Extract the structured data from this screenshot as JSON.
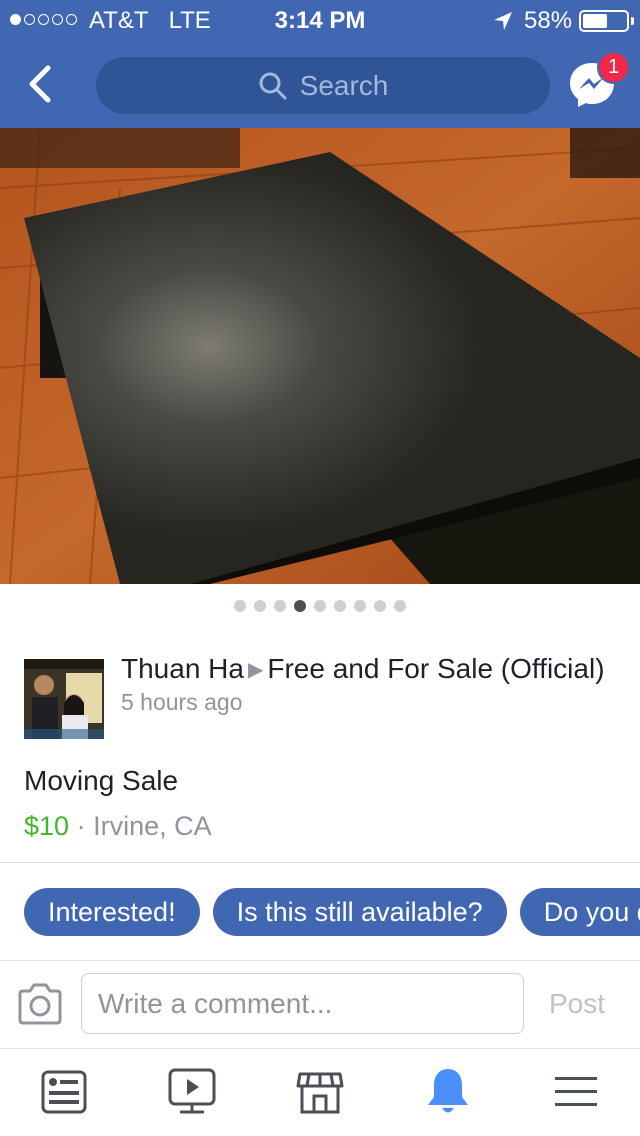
{
  "status_bar": {
    "carrier": "AT&T",
    "network": "LTE",
    "time": "3:14 PM",
    "battery_percent": "58%",
    "battery_level": 0.58,
    "signal_bars": 1,
    "icons": [
      "signal-dots",
      "location-arrow-icon",
      "battery-icon"
    ]
  },
  "nav": {
    "back_icon": "chevron-left-icon",
    "search_placeholder": "Search",
    "messenger_icon": "messenger-icon",
    "messenger_badge": "1"
  },
  "photo": {
    "carousel_count": 9,
    "active_index": 3
  },
  "post": {
    "author": "Thuan Ha",
    "group": "Free and For Sale (Official)",
    "time_ago": "5 hours ago",
    "item_title": "Moving Sale",
    "price": "$10",
    "separator": "·",
    "location": "Irvine, CA"
  },
  "quick_replies": [
    "Interested!",
    "Is this still available?",
    "Do you deliver?"
  ],
  "comment": {
    "placeholder": "Write a comment...",
    "post_label": "Post"
  },
  "tab_bar": [
    {
      "name": "news-feed",
      "icon": "news-feed-icon",
      "active": false
    },
    {
      "name": "video",
      "icon": "video-icon",
      "active": false
    },
    {
      "name": "marketplace",
      "icon": "marketplace-icon",
      "active": false
    },
    {
      "name": "notifications",
      "icon": "bell-icon",
      "active": true
    },
    {
      "name": "menu",
      "icon": "menu-icon",
      "active": false
    }
  ],
  "colors": {
    "brand_blue": "#4267b2",
    "price_green": "#42b72a",
    "active_tab": "#4a8ff7",
    "inactive_tab": "#4b4f56",
    "badge_red": "#f02849"
  }
}
